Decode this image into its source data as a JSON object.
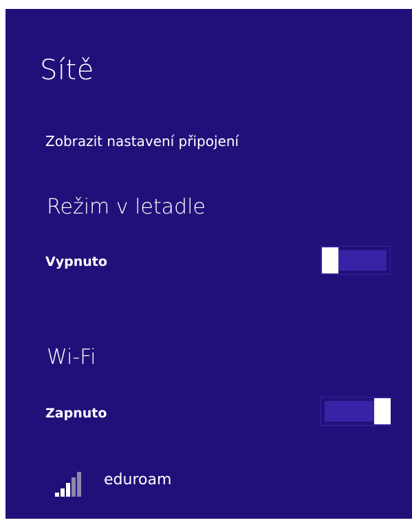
{
  "panel": {
    "title": "Sítě",
    "settings_link": "Zobrazit nastavení připojení"
  },
  "airplane_mode": {
    "title": "Režim v letadle",
    "state": "Vypnuto",
    "enabled": false
  },
  "wifi": {
    "title": "Wi-Fi",
    "state": "Zapnuto",
    "enabled": true
  },
  "networks": [
    {
      "name": "eduroam",
      "icon": "wifi-signal-icon",
      "signal_bars": 3,
      "signal_bars_max": 5
    }
  ],
  "colors": {
    "background": "#22107a",
    "toggle_accent": "#3a22a6",
    "text": "#ffffff"
  }
}
